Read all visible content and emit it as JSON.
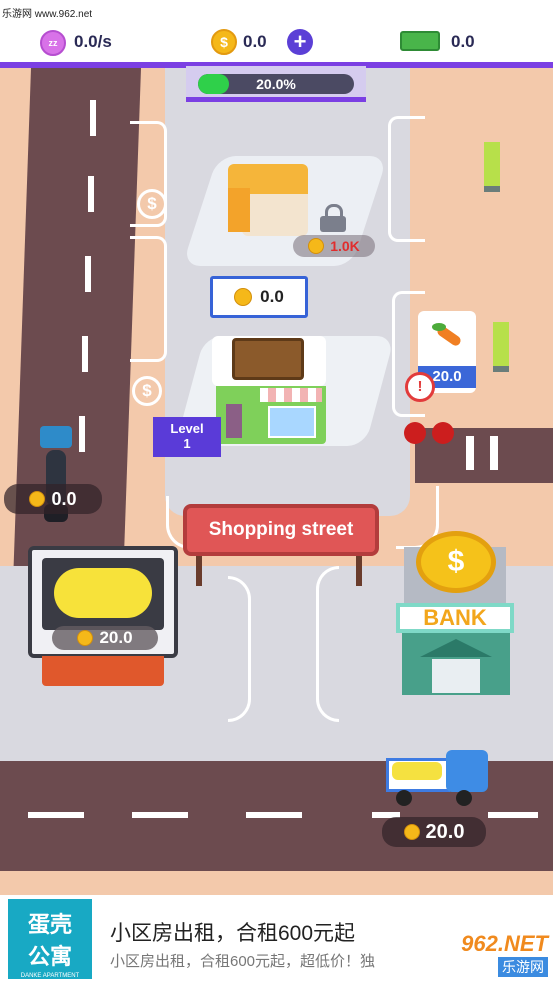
{
  "watermark": "乐游网 www.962.net",
  "hud": {
    "income_rate": "0.0/s",
    "coins": "0.0",
    "cash": "0.0",
    "progress_label": "20.0%",
    "progress_fraction": 0.2
  },
  "map": {
    "locked_cost": "1.0K",
    "shop_counter": "0.0",
    "level_label": "Level",
    "level_value": "1",
    "veg_stand_value": "20.0",
    "bike_earnings": "0.0",
    "sign_text": "Shopping street",
    "fryer_value": "20.0",
    "bank_label": "BANK",
    "truck_value": "20.0"
  },
  "ad": {
    "logo_line1": "蛋壳",
    "logo_line2": "公寓",
    "logo_sub": "DANKE APARTMENT",
    "title": "小区房出租，合租600元起",
    "subtitle": "小区房出租，合租600元起，超低价！独",
    "brand": "962.NET",
    "brand_sub": "乐游网"
  },
  "colors": {
    "accent": "#7b3fe3",
    "road": "#6c4b4f",
    "ground": "#f3c9ab",
    "progress_fill": "#2fd04a",
    "sign_red": "#e05656"
  }
}
